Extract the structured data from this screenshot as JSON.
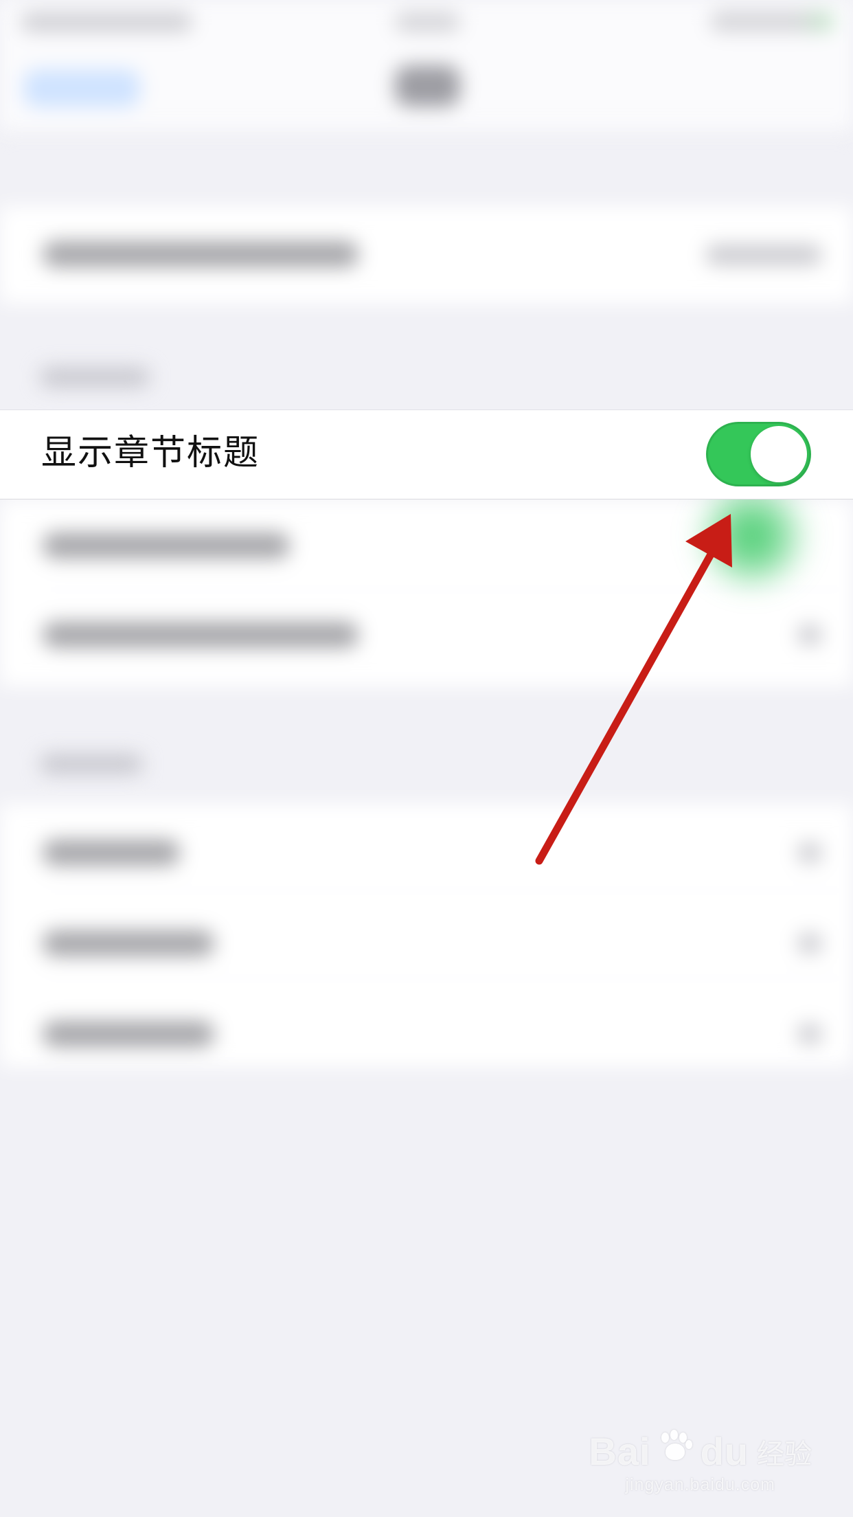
{
  "focused_setting": {
    "label": "显示章节标题",
    "toggle_state": "on"
  },
  "annotation": {
    "arrow_color": "#c81d16"
  },
  "watermark": {
    "brand": "Bai",
    "brand_suffix": "du",
    "suffix": "经验",
    "url": "jingyan.baidu.com"
  },
  "colors": {
    "toggle_on": "#34c759",
    "background": "#f1f1f6",
    "section_background": "#ffffff"
  }
}
